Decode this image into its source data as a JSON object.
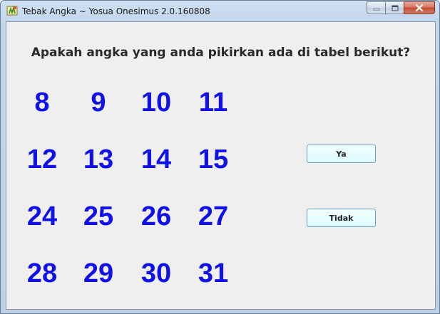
{
  "window": {
    "title": "Tebak Angka ~ Yosua Onesimus 2.0.160808"
  },
  "main": {
    "question": "Apakah angka yang anda pikirkan ada di tabel berikut?",
    "numbers": [
      [
        "8",
        "9",
        "10",
        "11"
      ],
      [
        "12",
        "13",
        "14",
        "15"
      ],
      [
        "24",
        "25",
        "26",
        "27"
      ],
      [
        "28",
        "29",
        "30",
        "31"
      ]
    ],
    "yes_label": "Ya",
    "no_label": "Tidak"
  },
  "colors": {
    "number_color": "#1010e8",
    "button_fill": "#dcfbff",
    "client_background": "#efefef"
  },
  "icons": [
    "app-icon",
    "minimize-icon",
    "maximize-icon",
    "close-icon"
  ]
}
